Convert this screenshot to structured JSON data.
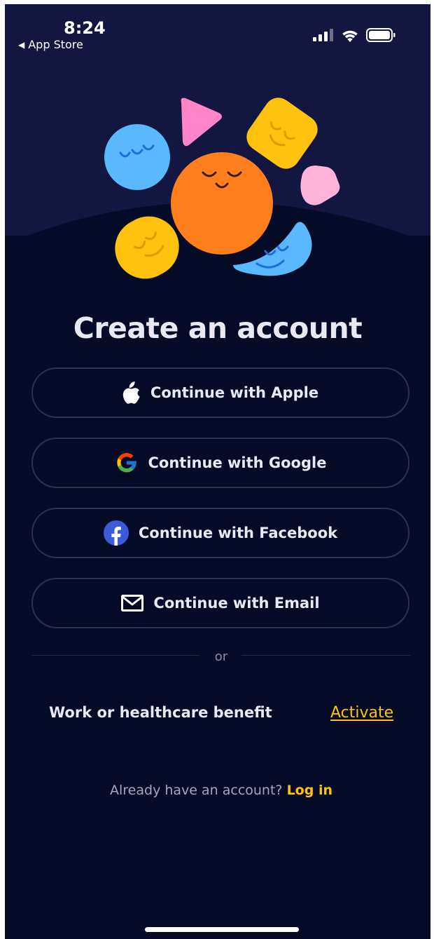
{
  "status_bar": {
    "time": "8:24",
    "back_label": "App Store",
    "icons": [
      "cellular-signal-icon",
      "wifi-icon",
      "battery-icon"
    ]
  },
  "illustration": {
    "name": "smiling-shapes-illustration",
    "colors": {
      "orange": "#ff7e1d",
      "blue": "#5ab8ff",
      "yellow": "#ffc20e",
      "pink": "#ff84c8",
      "light_pink": "#ffb3d9"
    }
  },
  "title": "Create an account",
  "auth_buttons": {
    "apple": "Continue with Apple",
    "google": "Continue with Google",
    "facebook": "Continue with Facebook",
    "email": "Continue with Email"
  },
  "divider_text": "or",
  "benefit": {
    "label": "Work or healthcare benefit",
    "action": "Activate"
  },
  "login": {
    "prompt": "Already have an account?",
    "action": "Log in"
  },
  "colors": {
    "background": "#050a26",
    "header_band": "#121640",
    "accent": "#ffc20e",
    "text": "#e9e9f2"
  }
}
